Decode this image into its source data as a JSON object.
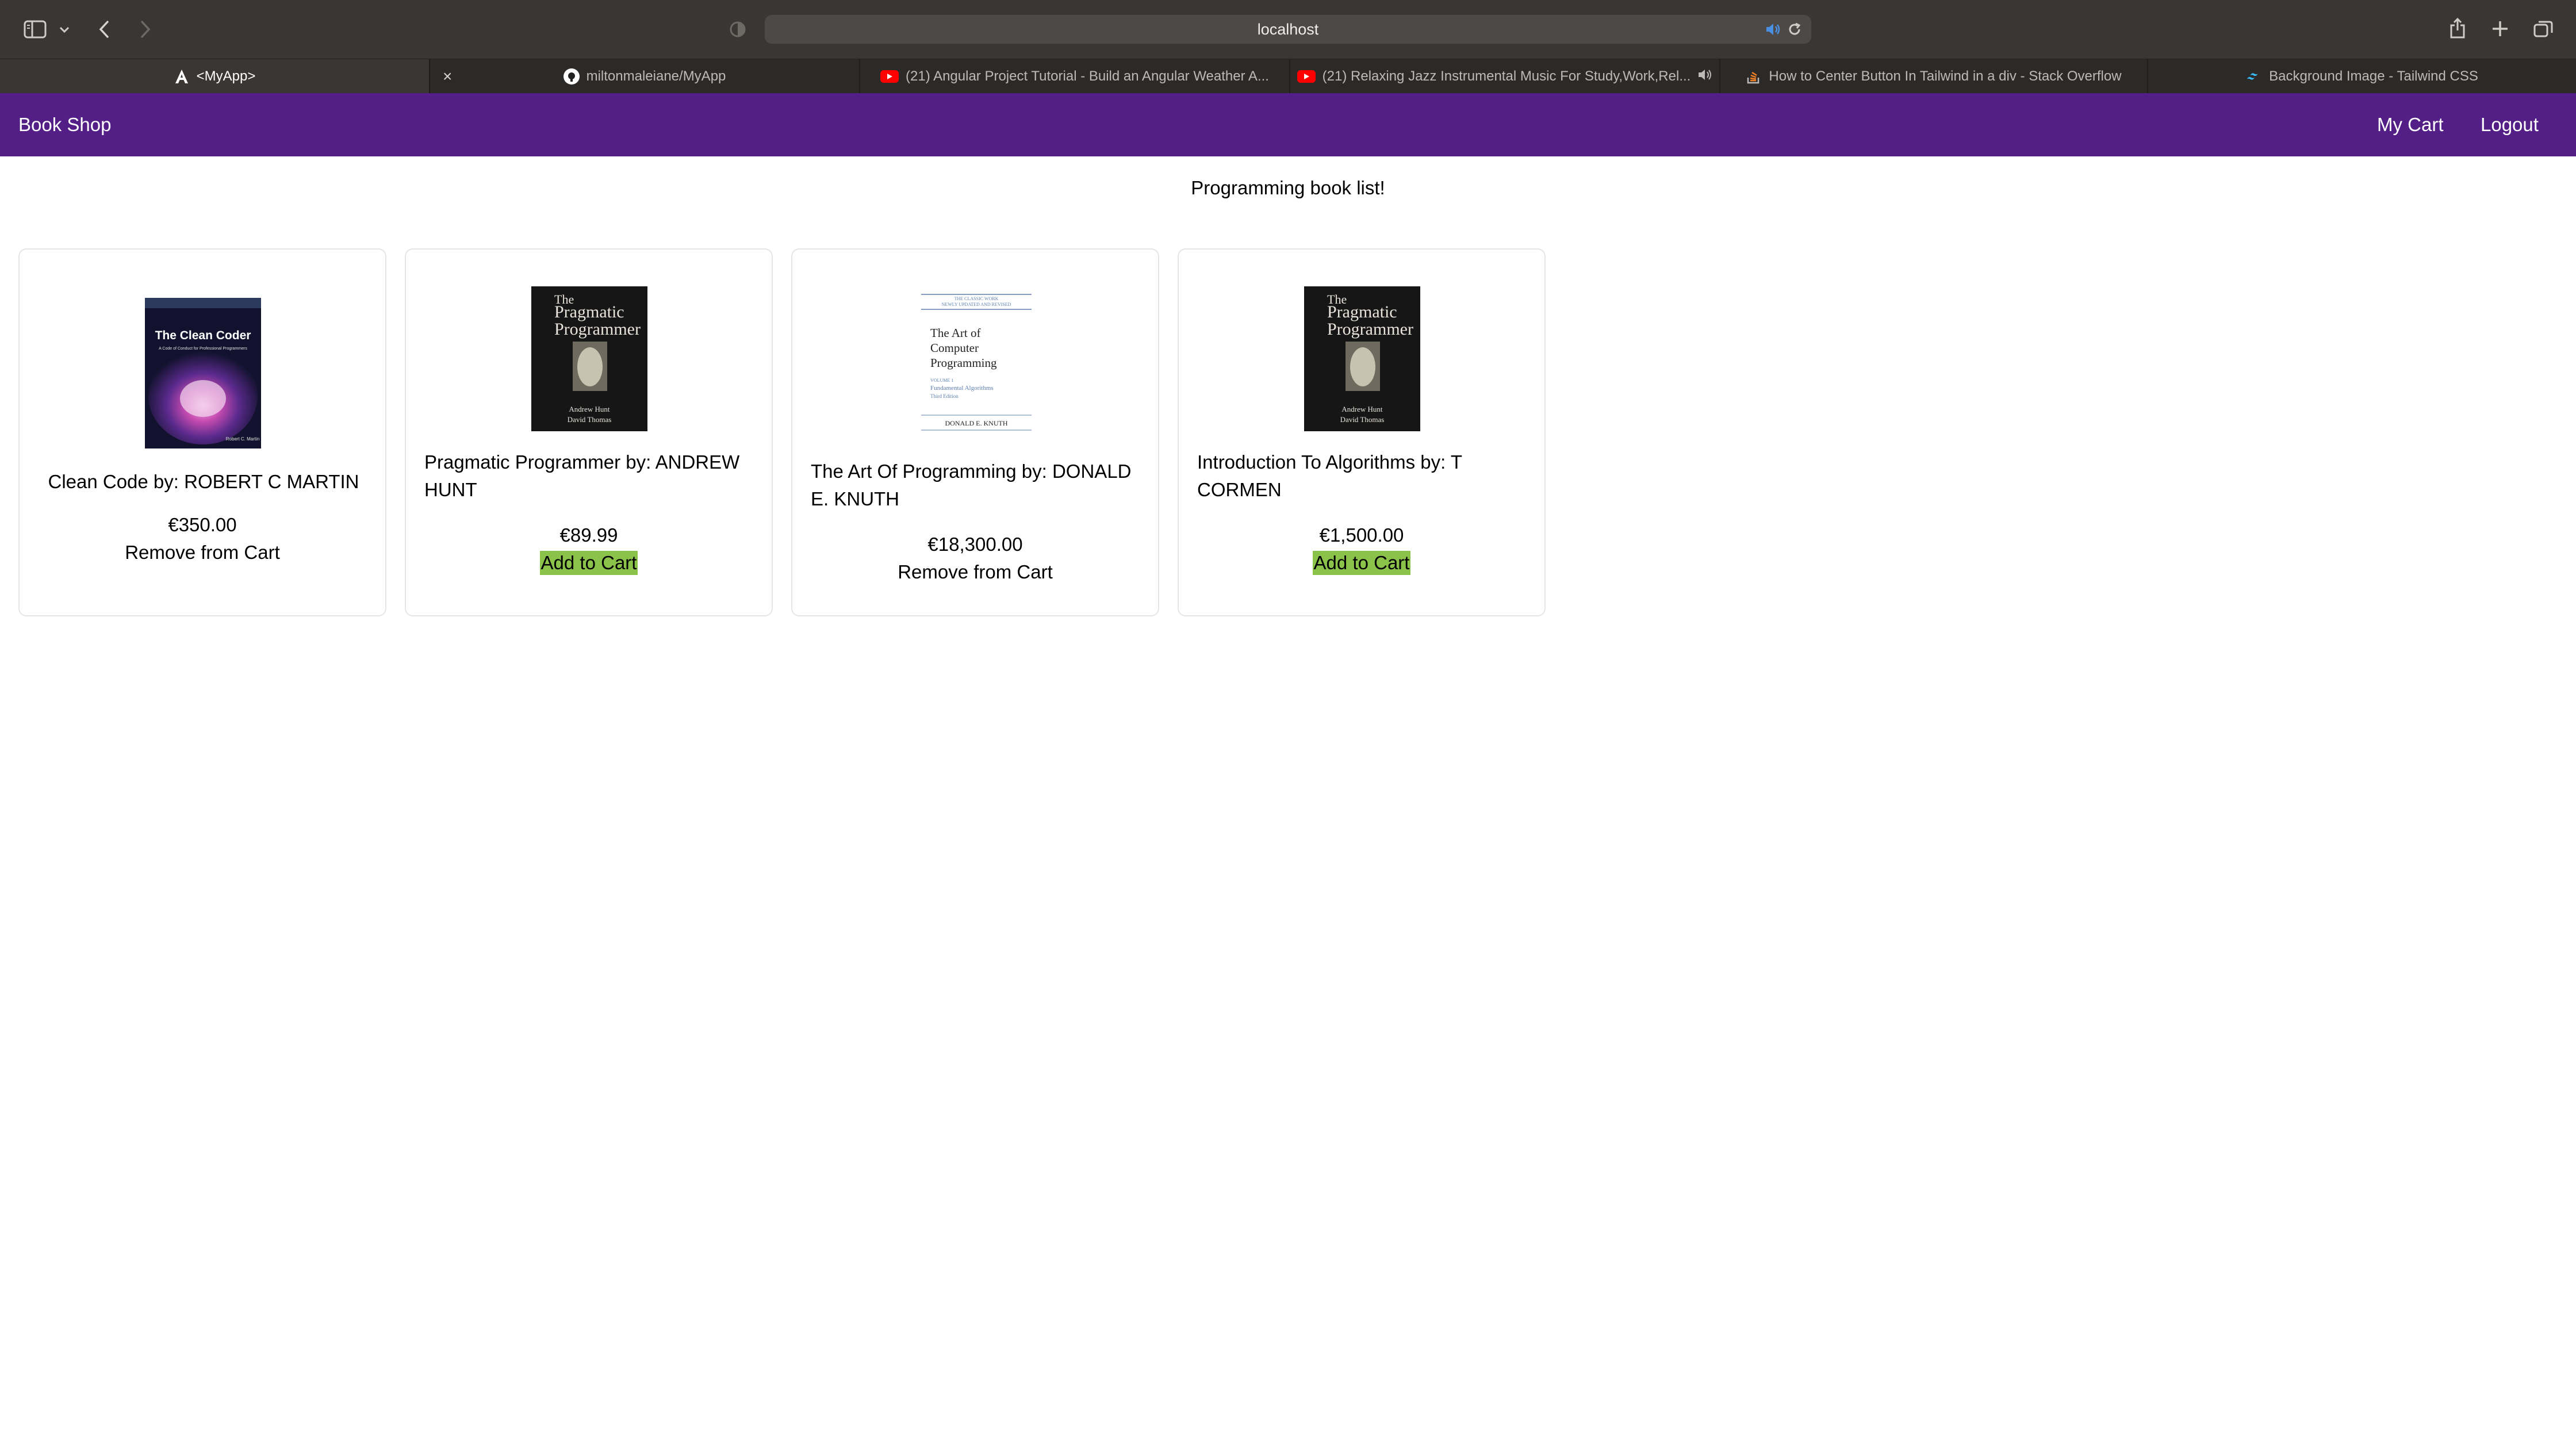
{
  "browser": {
    "url": "localhost",
    "icons": {
      "sidebar": "sidebar-icon",
      "back": "chevron-left-icon",
      "forward": "chevron-right-icon",
      "shield": "privacy-shield-icon",
      "audio": "speaker-icon",
      "reload": "reload-icon",
      "share": "share-icon",
      "new_tab": "plus-icon",
      "tab_overview": "tab-overview-icon"
    },
    "tabs": [
      {
        "label": "<MyApp>",
        "icon": "angular-icon",
        "active": true
      },
      {
        "label": "miltonmaleiane/MyApp",
        "icon": "github-icon",
        "active": false
      },
      {
        "label": "(21) Angular Project Tutorial - Build an Angular Weather A...",
        "icon": "youtube-icon",
        "active": false
      },
      {
        "label": "(21) Relaxing Jazz Instrumental Music For Study,Work,Rel...",
        "icon": "youtube-icon",
        "active": false
      },
      {
        "label": "How to Center Button In Tailwind in a div - Stack Overflow",
        "icon": "stackoverflow-icon",
        "active": false
      },
      {
        "label": "Background Image - Tailwind CSS",
        "icon": "tailwind-icon",
        "active": false
      }
    ]
  },
  "nav": {
    "brand": "Book Shop",
    "cart": "My Cart",
    "logout": "Logout",
    "color": "#531f86"
  },
  "page": {
    "heading": "Programming book list!"
  },
  "books": [
    {
      "title": "Clean Code by: ROBERT C MARTIN",
      "price": "€350.00",
      "action": "Remove from Cart",
      "cover": {
        "title": "The Clean Coder",
        "subtitle": "A Code of Conduct for Professional Programmers",
        "author": "Robert C. Martin"
      }
    },
    {
      "title": "Pragmatic Programmer by: ANDREW HUNT",
      "price": "€89.99",
      "action": "Add to Cart",
      "cover": {
        "title1": "The",
        "title2": "Pragmatic",
        "title3": "Programmer",
        "author1": "Andrew Hunt",
        "author2": "David Thomas"
      }
    },
    {
      "title": "The Art Of Programming by: DONALD E. KNUTH",
      "price": "€18,300.00",
      "action": "Remove from Cart",
      "cover": {
        "top1": "THE CLASSIC WORK",
        "top2": "NEWLY UPDATED AND REVISED",
        "title1": "The Art of",
        "title2": "Computer",
        "title3": "Programming",
        "vol": "VOLUME 1",
        "subtitle": "Fundamental Algorithms",
        "edition": "Third Edition",
        "author": "DONALD E. KNUTH"
      }
    },
    {
      "title": "Introduction To Algorithms by: T CORMEN",
      "price": "€1,500.00",
      "action": "Add to Cart",
      "cover": {
        "title1": "The",
        "title2": "Pragmatic",
        "title3": "Programmer",
        "author1": "Andrew Hunt",
        "author2": "David Thomas"
      }
    }
  ],
  "colors": {
    "add_button": "#8bc34a",
    "browser_chrome": "#3a3634"
  }
}
